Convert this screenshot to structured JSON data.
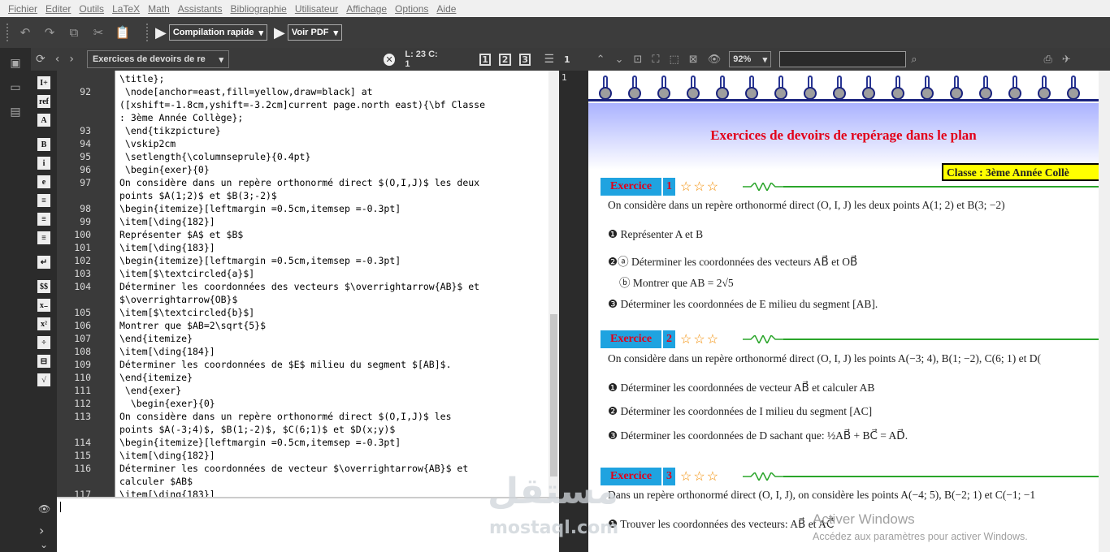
{
  "menu": [
    "Fichier",
    "Editer",
    "Outils",
    "LaTeX",
    "Math",
    "Assistants",
    "Bibliographie",
    "Utilisateur",
    "Affichage",
    "Options",
    "Aide"
  ],
  "toolbar": {
    "compile_label": "Compilation rapide",
    "view_label": "Voir PDF"
  },
  "editor": {
    "doc_name": "Exercices de devoirs de re",
    "status": "L: 23 C: 1",
    "buttons": [
      "1",
      "2",
      "3"
    ],
    "lines": [
      {
        "n": "",
        "t": "\\title};"
      },
      {
        "n": "92",
        "t": " \\node[anchor=east,fill=yellow,draw=black] at"
      },
      {
        "n": "",
        "t": "([xshift=-1.8cm,yshift=-3.2cm]current page.north east){\\bf Classe"
      },
      {
        "n": "",
        "t": ": 3ème Année Collège};"
      },
      {
        "n": "93",
        "t": " \\end{tikzpicture}"
      },
      {
        "n": "94",
        "t": " \\vskip2cm"
      },
      {
        "n": "95",
        "t": " \\setlength{\\columnseprule}{0.4pt}"
      },
      {
        "n": "96",
        "t": " \\begin{exer}{0}"
      },
      {
        "n": "97",
        "t": "On considère dans un repère orthonormé direct $(O,I,J)$ les deux"
      },
      {
        "n": "",
        "t": "points $A(1;2)$ et $B(3;-2)$"
      },
      {
        "n": "98",
        "t": "\\begin{itemize}[leftmargin =0.5cm,itemsep =-0.3pt]"
      },
      {
        "n": "99",
        "t": "\\item[\\ding{182}]"
      },
      {
        "n": "100",
        "t": "Représenter $A$ et $B$"
      },
      {
        "n": "101",
        "t": "\\item[\\ding{183}]"
      },
      {
        "n": "102",
        "t": "\\begin{itemize}[leftmargin =0.5cm,itemsep =-0.3pt]"
      },
      {
        "n": "103",
        "t": "\\item[$\\textcircled{a}$]"
      },
      {
        "n": "104",
        "t": "Déterminer les coordonnées des vecteurs $\\overrightarrow{AB}$ et"
      },
      {
        "n": "",
        "t": "$\\overrightarrow{OB}$"
      },
      {
        "n": "105",
        "t": "\\item[$\\textcircled{b}$]"
      },
      {
        "n": "106",
        "t": "Montrer que $AB=2\\sqrt{5}$"
      },
      {
        "n": "107",
        "t": "\\end{itemize}"
      },
      {
        "n": "108",
        "t": "\\item[\\ding{184}]"
      },
      {
        "n": "109",
        "t": "Déterminer les coordonnées de $E$ milieu du segment $[AB]$."
      },
      {
        "n": "110",
        "t": "\\end{itemize}"
      },
      {
        "n": "111",
        "t": " \\end{exer}"
      },
      {
        "n": "112",
        "t": "  \\begin{exer}{0}"
      },
      {
        "n": "113",
        "t": "On considère dans un repère orthonormé direct $(O,I,J)$ les"
      },
      {
        "n": "",
        "t": "points $A(-3;4)$, $B(1;-2)$, $C(6;1)$ et $D(x;y)$"
      },
      {
        "n": "114",
        "t": "\\begin{itemize}[leftmargin =0.5cm,itemsep =-0.3pt]"
      },
      {
        "n": "115",
        "t": "\\item[\\ding{182}]"
      },
      {
        "n": "116",
        "t": "Déterminer les coordonnées de vecteur $\\overrightarrow{AB}$ et"
      },
      {
        "n": "",
        "t": "calculer $AB$"
      },
      {
        "n": "117",
        "t": "\\item[\\ding{183}]"
      }
    ]
  },
  "pdf": {
    "zoom": "92%",
    "page_number": "1",
    "title": "Exercices de devoirs de repérage dans le plan",
    "classe": "Classe : 3ème Année Collè",
    "exercise_label": "Exercice",
    "ex1": {
      "num": "1",
      "intro": "On considère dans un repère orthonormé direct (O, I, J) les deux points A(1; 2) et B(3; −2)",
      "items": [
        "❶ Représenter A et B",
        "❷ⓐ  Déterminer les coordonnées des vecteurs AB⃗ et OB⃗",
        "ⓑ  Montrer que AB = 2√5",
        "❸ Déterminer les coordonnées de E milieu du segment [AB]."
      ]
    },
    "ex2": {
      "num": "2",
      "intro": "On considère dans un repère orthonormé direct (O, I, J) les points A(−3; 4), B(1; −2), C(6; 1) et D(",
      "items": [
        "❶ Déterminer les coordonnées de vecteur AB⃗ et calculer AB",
        "❷ Déterminer les coordonnées de I milieu du segment [AC]",
        "❸ Déterminer les coordonnées de D sachant que:  ½AB⃗ + BC⃗ = AD⃗."
      ]
    },
    "ex3": {
      "num": "3",
      "intro": "Dans un repère orthonormé direct (O, I, J), on considère les points A(−4; 5), B(−2; 1) et C(−1; −1",
      "items": [
        "❶ Trouver les coordonnées des vecteurs: AB⃗ et AC⃗"
      ]
    }
  },
  "overlay": {
    "wm_arabic": "مستقل",
    "wm_latin": "mostaql.com",
    "activate": "Activer Windows",
    "activate_sub": "Accédez aux paramètres pour activer Windows."
  }
}
